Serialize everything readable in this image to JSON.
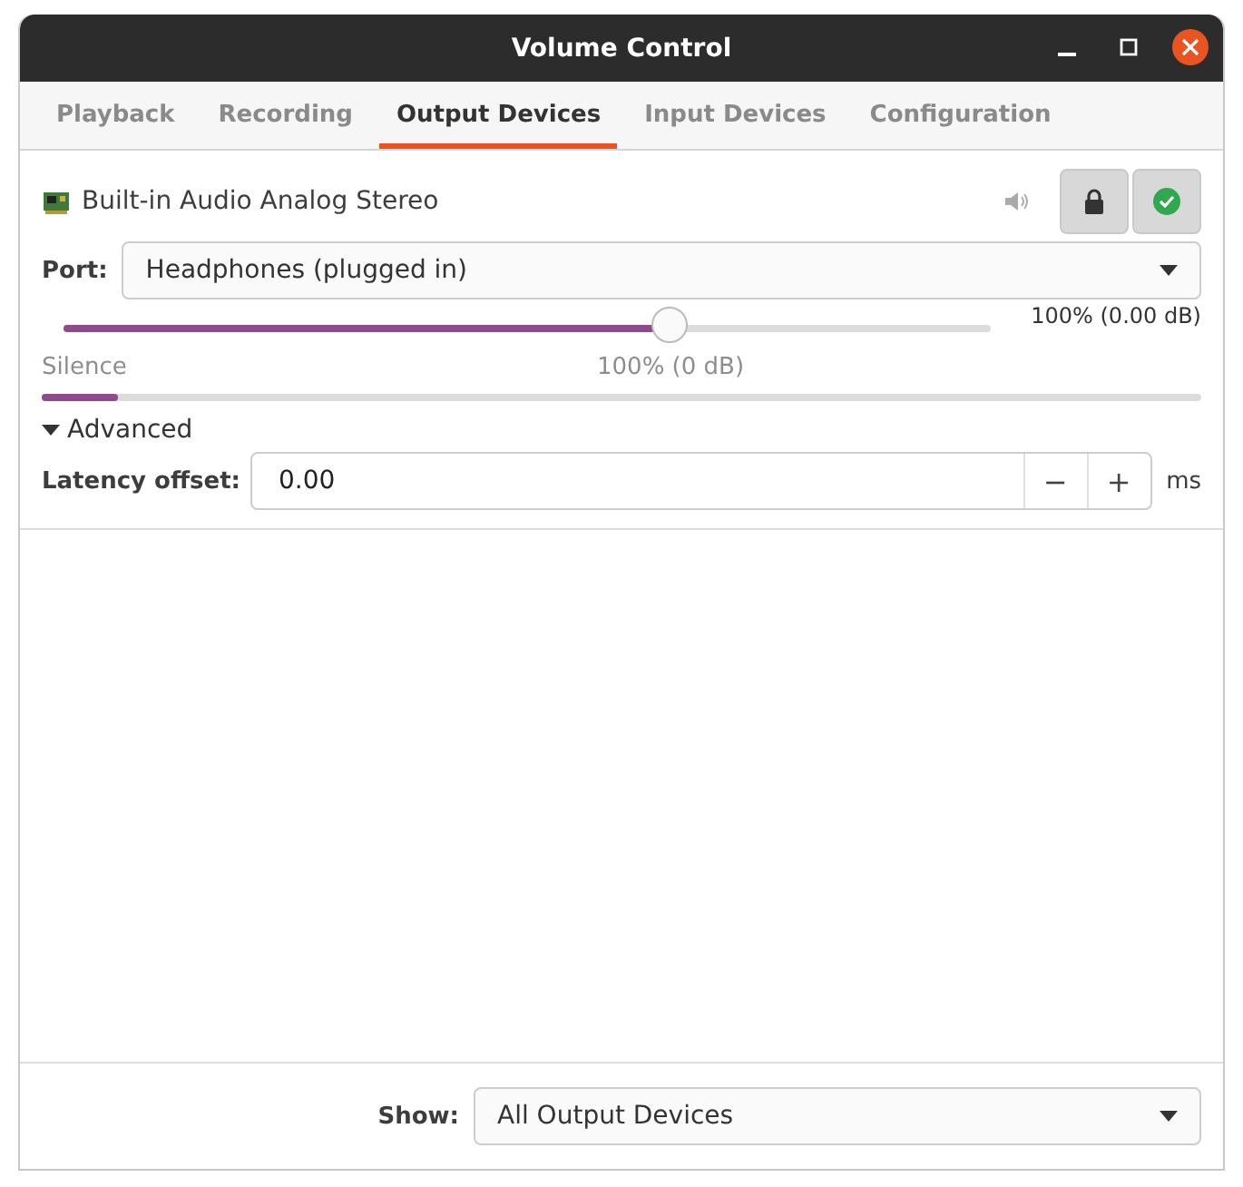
{
  "window": {
    "title": "Volume Control"
  },
  "tabs": [
    {
      "label": "Playback",
      "selected": false
    },
    {
      "label": "Recording",
      "selected": false
    },
    {
      "label": "Output Devices",
      "selected": true
    },
    {
      "label": "Input Devices",
      "selected": false
    },
    {
      "label": "Configuration",
      "selected": false
    }
  ],
  "device": {
    "name": "Built-in Audio Analog Stereo",
    "muted": false,
    "locked": true,
    "is_default": true,
    "port_label": "Port:",
    "port": "Headphones (plugged in)",
    "volume": {
      "level": 0.654,
      "reading": "100% (0.00 dB)",
      "mark_left": "Silence",
      "mark_center": "100% (0 dB)"
    },
    "peak": {
      "level": 0.066
    },
    "advanced": {
      "label": "Advanced",
      "expanded": true
    },
    "latency": {
      "label": "Latency offset:",
      "value": "0.00",
      "minus": "−",
      "plus": "+",
      "unit": "ms"
    }
  },
  "footer": {
    "label": "Show:",
    "value": "All Output Devices"
  }
}
